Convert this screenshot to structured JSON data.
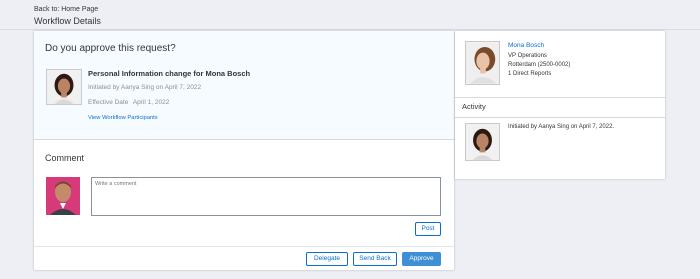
{
  "header": {
    "breadcrumb": "Back to: Home Page",
    "title": "Workflow Details"
  },
  "request": {
    "question": "Do you approve this request?",
    "title": "Personal Information change for Mona Bosch",
    "initiated": "Initiated by Aanya Sing on April 7, 2022",
    "effective_label": "Effective Date",
    "effective_value": "April 1, 2022",
    "participants_link": "View Workflow Participants"
  },
  "comment": {
    "heading": "Comment",
    "placeholder": "Write a comment",
    "value": "",
    "post_label": "Post"
  },
  "actions": {
    "delegate_label": "Delegate",
    "send_back_label": "Send Back",
    "approve_label": "Approve"
  },
  "profile": {
    "name": "Mona Bosch",
    "role": "VP Operations",
    "location": "Rotterdam (2500-0002)",
    "reports": "1 Direct Reports"
  },
  "activity": {
    "heading": "Activity",
    "items": [
      {
        "text": "Initiated by Aanya Sing on April 7, 2022."
      }
    ]
  },
  "colors": {
    "accent": "#0a6ed1",
    "approve": "#3f8fd4",
    "page_background": "#edeff4",
    "request_background": "#f5fbfe"
  },
  "icons": [
    "user-avatar-aanya",
    "user-avatar-commenter",
    "user-avatar-mona"
  ]
}
